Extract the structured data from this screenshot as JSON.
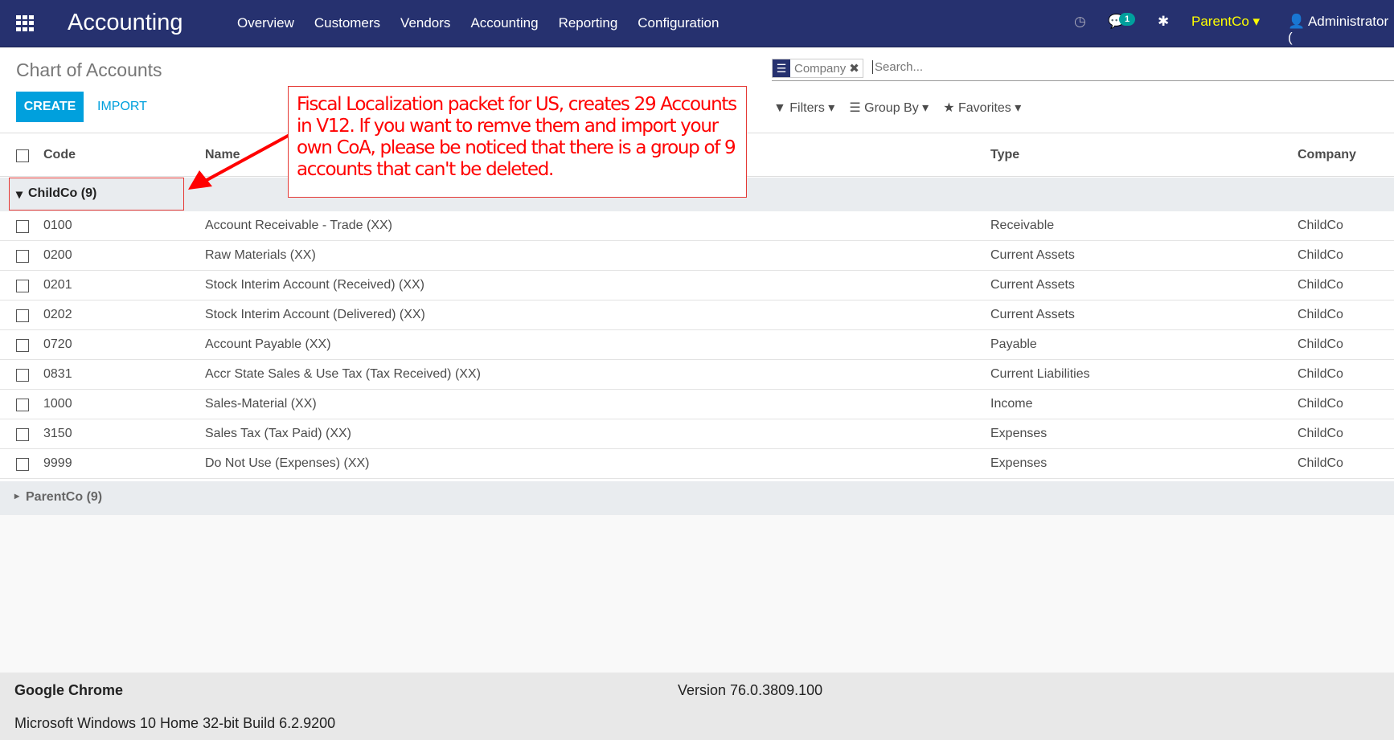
{
  "navbar": {
    "brand": "Accounting",
    "menu": [
      "Overview",
      "Customers",
      "Vendors",
      "Accounting",
      "Reporting",
      "Configuration"
    ],
    "messages_count": "1",
    "company": "ParentCo",
    "user": "Administrator ("
  },
  "page": {
    "title": "Chart of Accounts",
    "create_label": "CREATE",
    "import_label": "IMPORT"
  },
  "search": {
    "facet": "Company",
    "placeholder": "Search..."
  },
  "toolbar": {
    "filters": "Filters",
    "group_by": "Group By",
    "favorites": "Favorites"
  },
  "table": {
    "columns": [
      "Code",
      "Name",
      "Type",
      "Company"
    ],
    "groups": [
      {
        "label": "ChildCo (9)",
        "expanded": true
      },
      {
        "label": "ParentCo (9)",
        "expanded": false
      }
    ],
    "rows": [
      {
        "code": "0100",
        "name": "Account Receivable - Trade (XX)",
        "type": "Receivable",
        "company": "ChildCo"
      },
      {
        "code": "0200",
        "name": "Raw Materials (XX)",
        "type": "Current Assets",
        "company": "ChildCo"
      },
      {
        "code": "0201",
        "name": "Stock Interim Account (Received) (XX)",
        "type": "Current Assets",
        "company": "ChildCo"
      },
      {
        "code": "0202",
        "name": "Stock Interim Account (Delivered) (XX)",
        "type": "Current Assets",
        "company": "ChildCo"
      },
      {
        "code": "0720",
        "name": "Account Payable (XX)",
        "type": "Payable",
        "company": "ChildCo"
      },
      {
        "code": "0831",
        "name": "Accr State Sales & Use Tax (Tax Received) (XX)",
        "type": "Current Liabilities",
        "company": "ChildCo"
      },
      {
        "code": "1000",
        "name": "Sales-Material (XX)",
        "type": "Income",
        "company": "ChildCo"
      },
      {
        "code": "3150",
        "name": "Sales Tax (Tax Paid) (XX)",
        "type": "Expenses",
        "company": "ChildCo"
      },
      {
        "code": "9999",
        "name": "Do Not Use (Expenses) (XX)",
        "type": "Expenses",
        "company": "ChildCo"
      }
    ]
  },
  "annotation": "Fiscal Localization packet for US, creates 29 Accounts in V12. If you want to remve them and import your own CoA, please be noticed that there is a group of 9 accounts that can't be deleted.",
  "footer": {
    "app": "Google Chrome",
    "version": "Version 76.0.3809.100",
    "os": "Microsoft Windows 10 Home 32-bit Build 6.2.9200"
  },
  "colors": {
    "navbar": "#26316f",
    "accent": "#00a0dd",
    "company": "#ffff00",
    "annotation": "#ff0000"
  }
}
